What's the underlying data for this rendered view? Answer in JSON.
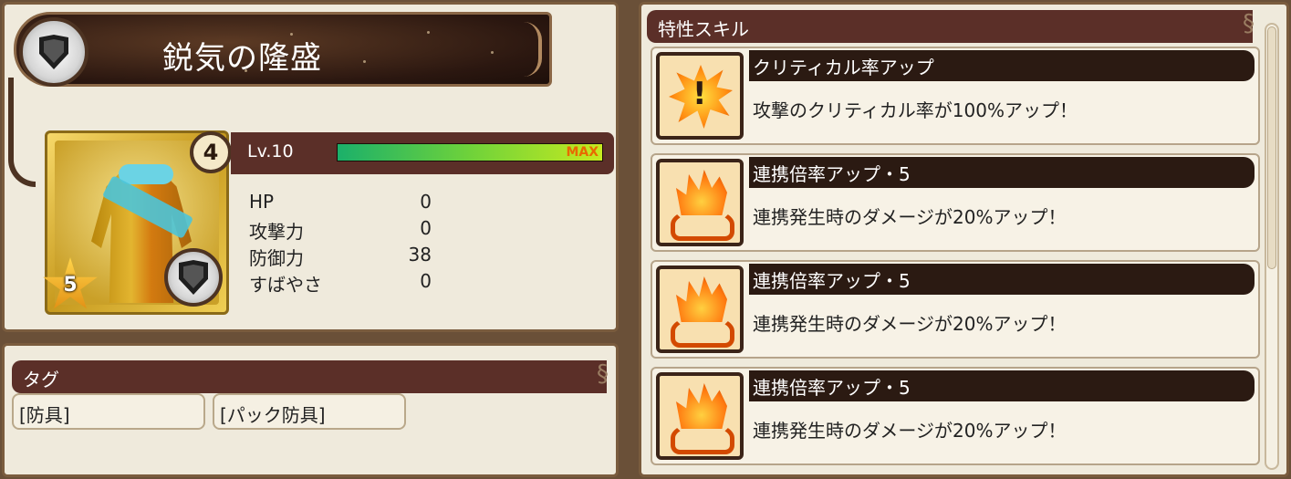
{
  "item": {
    "name": "鋭気の隆盛",
    "type_icon": "shield-icon",
    "rarity_stars": "5",
    "plus_level": "4"
  },
  "level": {
    "label": "Lv.10",
    "max_label": "MAX",
    "progress": 1.0
  },
  "stats": [
    {
      "label": "HP",
      "value": "0"
    },
    {
      "label": "攻撃力",
      "value": "0"
    },
    {
      "label": "防御力",
      "value": "38"
    },
    {
      "label": "すばやさ",
      "value": "0"
    }
  ],
  "tags": {
    "header": "タグ",
    "items": [
      "[防具]",
      "[パック防具]"
    ]
  },
  "skills": {
    "header": "特性スキル",
    "items": [
      {
        "name": "クリティカル率アップ",
        "description": "攻撃のクリティカル率が100%アップ！",
        "icon": "critical-burst-icon"
      },
      {
        "name": "連携倍率アップ・5",
        "description": "連携発生時のダメージが20%アップ！",
        "icon": "flame-combo-icon"
      },
      {
        "name": "連携倍率アップ・5",
        "description": "連携発生時のダメージが20%アップ！",
        "icon": "flame-combo-icon"
      },
      {
        "name": "連携倍率アップ・5",
        "description": "連携発生時のダメージが20%アップ！",
        "icon": "flame-combo-icon"
      }
    ]
  },
  "colors": {
    "panel": "#efeadc",
    "frame": "#7a5c3e",
    "header_bar": "#5b2f28",
    "gauge_start": "#1bb06a",
    "gauge_end": "#c6ea20",
    "max_text": "#e86a00"
  }
}
